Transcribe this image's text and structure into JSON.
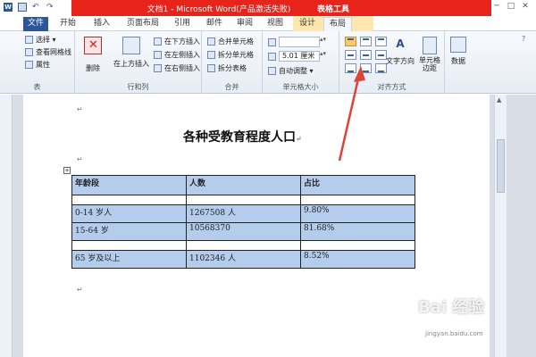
{
  "window": {
    "title": "文档1 - Microsoft Word(产品激活失败)",
    "context_label": "表格工具",
    "minimize": "─",
    "maximize": "□",
    "close": "✕"
  },
  "tabs": [
    "文件",
    "开始",
    "插入",
    "页面布局",
    "引用",
    "邮件",
    "审阅",
    "视图",
    "设计",
    "布局"
  ],
  "ribbon": {
    "table_group": {
      "label": "表",
      "select": "选择 ▾",
      "gridlines": "查看网格线",
      "properties": "属性"
    },
    "rows_cols_group": {
      "label": "行和列",
      "delete": "删除",
      "insert_above": "在上方插入",
      "insert_below": "在下方插入",
      "insert_left": "在左侧插入",
      "insert_right": "在右侧插入"
    },
    "merge_group": {
      "label": "合并",
      "merge_cells": "合并单元格",
      "split_cells": "拆分单元格",
      "split_table": "拆分表格"
    },
    "cell_size_group": {
      "label": "单元格大小",
      "height_value": "",
      "width_value": "5.01 厘米",
      "autofit": "自动调整 ▾"
    },
    "alignment_group": {
      "label": "对齐方式",
      "text_direction": "文字方向",
      "cell_margins": "单元格\n边距"
    },
    "data_group": {
      "label": "数据",
      "data": "数据"
    }
  },
  "document": {
    "title": "各种受教育程度人口",
    "paragraph_mark": "↵",
    "table": {
      "headers": [
        "年龄段",
        "人数",
        "占比"
      ],
      "rows": [
        [
          "0-14 岁人",
          "1267508 人",
          "9.80%"
        ],
        [
          "15-64 岁",
          "10568370",
          "81.68%"
        ],
        [
          "65 岁及以上",
          "1102346 人",
          "8.52%"
        ]
      ]
    }
  },
  "watermark": {
    "brand": "Bai 经验",
    "url": "jingyan.baidu.com"
  },
  "colors": {
    "title_bar_red": "#e8231a",
    "file_tab_blue": "#2b579a",
    "selection_blue": "#b4cdec",
    "arrow_red": "#e0413b"
  }
}
